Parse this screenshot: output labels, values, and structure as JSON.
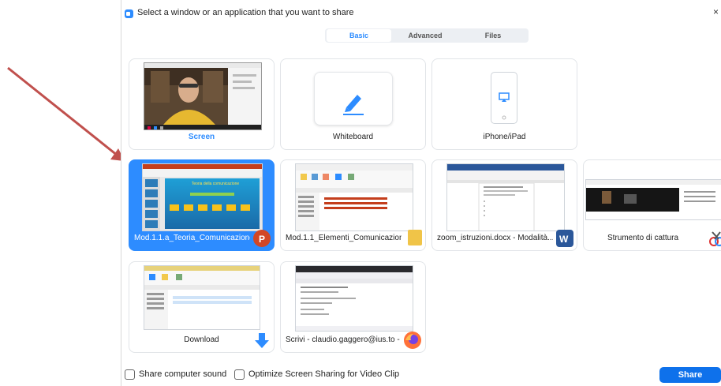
{
  "dialog": {
    "title": "Select a window or an application that you want to share",
    "close": "×"
  },
  "tabs": [
    {
      "label": "Basic",
      "active": true
    },
    {
      "label": "Advanced",
      "active": false
    },
    {
      "label": "Files",
      "active": false
    }
  ],
  "share_items": [
    {
      "label": "Screen",
      "type": "screen"
    },
    {
      "label": "Whiteboard",
      "type": "whiteboard"
    },
    {
      "label": "iPhone/iPad",
      "type": "ios"
    },
    {
      "label": "Mod.1.1.a_Teoria_Comunicazione...",
      "type": "window",
      "app_icon": "powerpoint-icon",
      "selected": true
    },
    {
      "label": "Mod.1.1_Elementi_Comunicazione",
      "type": "window",
      "app_icon": "folder-icon"
    },
    {
      "label": "zoom_istruzioni.docx  -  Modalità...",
      "type": "window",
      "app_icon": "word-icon"
    },
    {
      "label": "Strumento di cattura",
      "type": "window",
      "app_icon": "snipping-tool-icon"
    },
    {
      "label": "Download",
      "type": "window",
      "app_icon": "download-icon"
    },
    {
      "label": "Scrivi - claudio.gaggero@ius.to - ...",
      "type": "window",
      "app_icon": "firefox-icon"
    }
  ],
  "thumb_texts": {
    "presentation_title": "Teoria della comunicazione"
  },
  "footer": {
    "share_sound": "Share computer sound",
    "optimize_video": "Optimize Screen Sharing for Video Clip",
    "share_button": "Share"
  },
  "colors": {
    "accent": "#2d8cff",
    "share_button": "#0e71eb",
    "annotation_arrow": "#c0504d",
    "powerpoint": "#d24726",
    "word": "#2b579a"
  }
}
